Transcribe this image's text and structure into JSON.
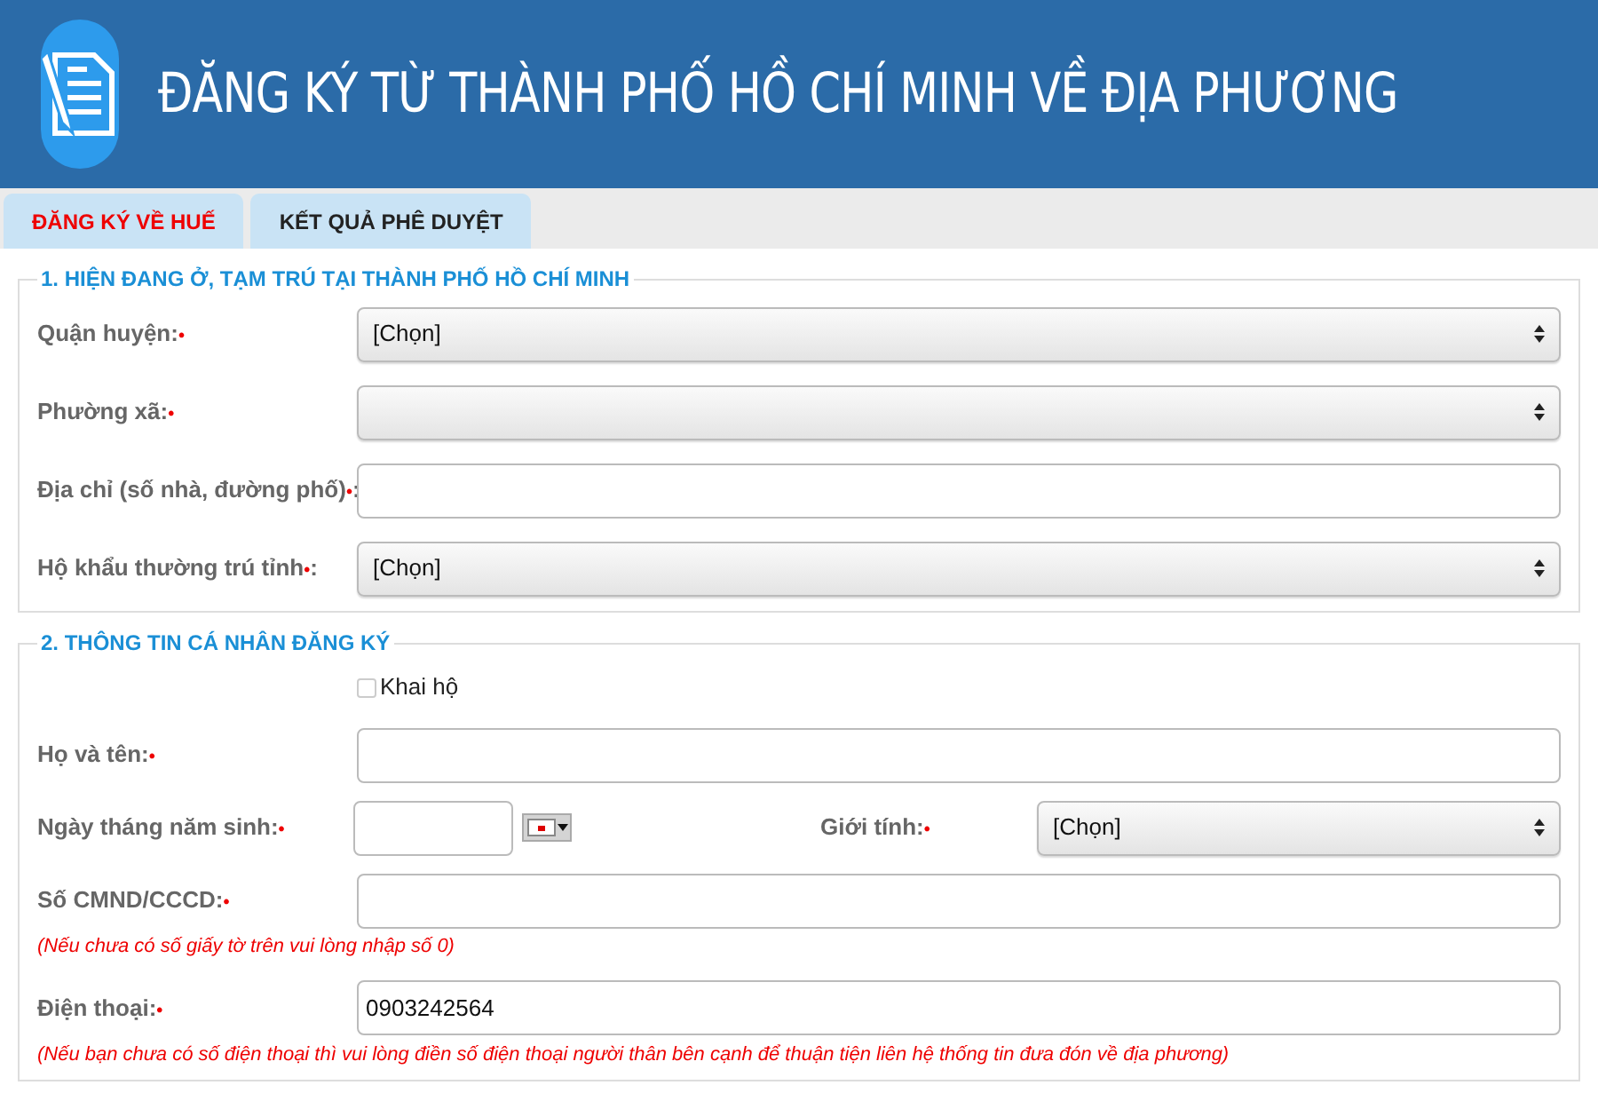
{
  "header": {
    "title": "ĐĂNG KÝ TỪ THÀNH PHỐ HỒ CHÍ MINH VỀ ĐỊA PHƯƠNG"
  },
  "tabs": [
    {
      "label": "ĐĂNG KÝ VỀ HUẾ",
      "selected": true
    },
    {
      "label": "KẾT QUẢ PHÊ DUYỆT",
      "selected": false
    }
  ],
  "sections": [
    {
      "title": "1. HIỆN ĐANG Ở, TẠM TRÚ TẠI THÀNH PHỐ HỒ CHÍ MINH",
      "rows": [
        {
          "kind": "select",
          "label": "Quận huyện:",
          "mark": "•",
          "value": "[Chọn]"
        },
        {
          "kind": "select",
          "label": "Phường xã:",
          "mark": "•"
        },
        {
          "kind": "text",
          "label": "Địa chỉ (số nhà, đường phố)",
          "mark": "•",
          "label_end": ":"
        },
        {
          "kind": "select",
          "label": "Hộ khẩu thường trú tỉnh",
          "mark": "•",
          "label_end": ":",
          "value": "[Chọn]"
        }
      ]
    },
    {
      "title": "2. THÔNG TIN CÁ NHÂN ĐĂNG KÝ",
      "rows": [
        {
          "kind": "checkbox",
          "label": "Khai hộ",
          "checked": false
        },
        {
          "kind": "text",
          "label": "Họ và tên:",
          "mark": "•"
        },
        {
          "kind": "date",
          "label": "Ngày tháng năm sinh:",
          "mark": "•",
          "side": {
            "label": "Giới tính:",
            "mark": "•",
            "value": "[Chọn]"
          }
        },
        {
          "kind": "text",
          "label": "Số CMND/CCCD:",
          "mark": "•",
          "note": "(Nếu chưa có số giấy tờ trên vui lòng nhập số 0)"
        },
        {
          "kind": "text",
          "label": "Điện thoại:",
          "mark": "•",
          "value": "0903242564",
          "note": "(Nếu bạn chưa có số điện thoại thì vui lòng điền số điện thoại người thân bên cạnh để thuận tiện liên hệ thống tin đưa đón về địa phương)"
        }
      ]
    }
  ]
}
